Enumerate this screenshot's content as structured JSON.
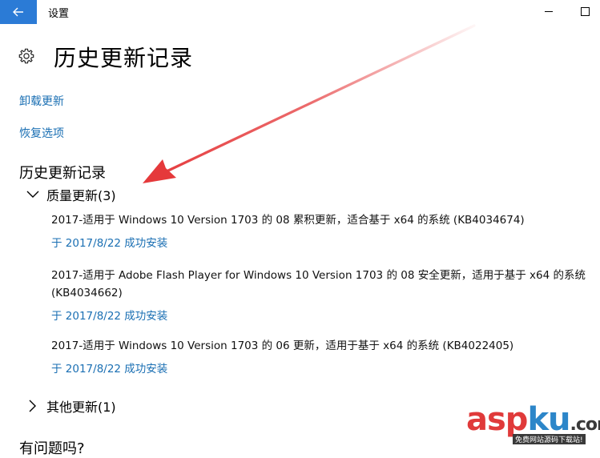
{
  "window": {
    "title": "设置"
  },
  "header": {
    "page_title": "历史更新记录"
  },
  "links": {
    "uninstall": "卸载更新",
    "recovery": "恢复选项"
  },
  "history": {
    "section_title": "历史更新记录",
    "groups": [
      {
        "label": "质量更新(3)",
        "expanded": true,
        "items": [
          {
            "name": "2017-适用于 Windows 10 Version 1703 的 08 累积更新，适合基于 x64 的系统 (KB4034674)",
            "status": "于 2017/8/22 成功安装"
          },
          {
            "name": "2017-适用于 Adobe Flash Player for Windows 10 Version 1703 的 08 安全更新，适用于基于 x64 的系统 (KB4034662)",
            "status": "于 2017/8/22 成功安装"
          },
          {
            "name": "2017-适用于 Windows 10 Version 1703 的 06 更新，适用于基于 x64 的系统 (KB4022405)",
            "status": "于 2017/8/22 成功安装"
          }
        ]
      },
      {
        "label": "其他更新(1)",
        "expanded": false
      }
    ]
  },
  "footer": {
    "partial_heading": "有问题吗?"
  },
  "watermark": {
    "brand_asp": "asp",
    "brand_ku": "ku",
    "brand_dot": ".com",
    "tagline": "免费网站源码下载站!"
  },
  "colors": {
    "accent": "#2b7bd6",
    "link": "#1a6fb3",
    "annotation_arrow": "#e5393b"
  }
}
